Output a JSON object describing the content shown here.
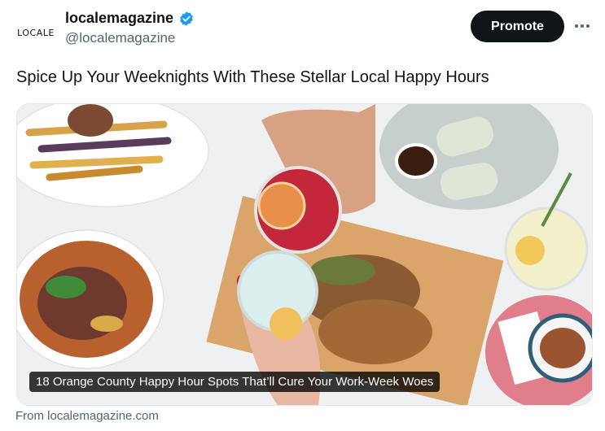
{
  "account": {
    "avatar_text": "LOCALE",
    "display_name": "localemagazine",
    "handle": "@localemagazine",
    "verified": true,
    "verified_color": "#1d9bf0"
  },
  "actions": {
    "promote_label": "Promote",
    "more_icon": "more-horizontal-icon"
  },
  "tweet": {
    "text": "Spice Up Your Weeknights With These Stellar Local Happy Hours"
  },
  "card": {
    "image_caption": "18 Orange County Happy Hour Spots That’ll Cure Your Work-Week Woes",
    "source": "From localemagazine.com"
  },
  "colors": {
    "promote_bg": "#0f1419",
    "secondary_text": "#536471"
  }
}
